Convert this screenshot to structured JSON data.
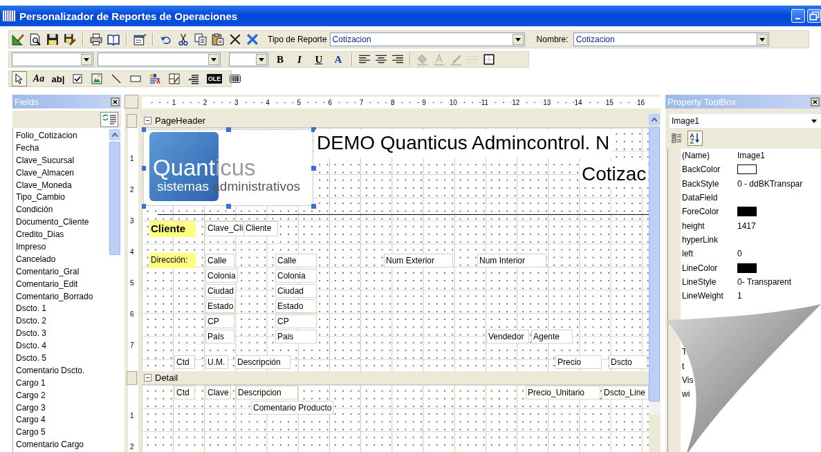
{
  "window": {
    "title": "Personalizador de Reportes de Operaciones"
  },
  "main_toolbar": {
    "buttons": [
      {
        "kind": "design"
      },
      {
        "kind": "preview"
      },
      {
        "kind": "save"
      },
      {
        "kind": "save_edit"
      },
      {
        "kind": "print"
      },
      {
        "kind": "book"
      },
      {
        "kind": "properties"
      },
      {
        "kind": "undo"
      },
      {
        "kind": "cut"
      },
      {
        "kind": "copy"
      },
      {
        "kind": "paste"
      },
      {
        "kind": "delete"
      },
      {
        "kind": "delete_all"
      }
    ],
    "report_type": {
      "label": "Tipo de Reporte",
      "value": "Cotizacion"
    },
    "report_name": {
      "label": "Nombre:",
      "value": "Cotizacion"
    }
  },
  "format_toolbar": {
    "style_buttons": [
      {
        "kind": "bold",
        "label": "B"
      },
      {
        "kind": "italic",
        "label": "I"
      },
      {
        "kind": "underline",
        "label": "U"
      },
      {
        "kind": "color",
        "label": "A"
      }
    ],
    "buttons": [
      {
        "kind": "align_left",
        "disabled": false
      },
      {
        "kind": "align_center",
        "disabled": false
      },
      {
        "kind": "align_right",
        "disabled": false
      },
      {
        "kind": "fill",
        "disabled": true
      },
      {
        "kind": "font_color",
        "disabled": true
      },
      {
        "kind": "line_color",
        "disabled": true
      },
      {
        "kind": "line_style",
        "disabled": true
      },
      {
        "kind": "border",
        "disabled": false
      }
    ]
  },
  "toolbox": [
    {
      "kind": "pointer",
      "selected": true
    },
    {
      "kind": "label",
      "label": "Aa",
      "selected": false
    },
    {
      "kind": "textbox",
      "label": "ab|",
      "selected": false
    },
    {
      "kind": "checkbox",
      "selected": false
    },
    {
      "kind": "picture",
      "selected": false
    },
    {
      "kind": "line",
      "selected": false
    },
    {
      "kind": "shape",
      "selected": false
    },
    {
      "kind": "rich_text",
      "selected": false
    },
    {
      "kind": "subreport",
      "selected": false
    },
    {
      "kind": "page_break",
      "selected": false
    },
    {
      "kind": "ole",
      "label": "OLE",
      "selected": false
    },
    {
      "kind": "barcode",
      "selected": false
    }
  ],
  "fields_panel": {
    "title": "Fields",
    "items": [
      "Folio_Cotizacion",
      "Fecha",
      "Clave_Sucursal",
      "Clave_Almacen",
      "Clave_Moneda",
      "Tipo_Cambio",
      "Condición",
      "Documento_Cliente",
      "Credito_Dias",
      "Impreso",
      "Cancelado",
      "Comentario_Gral",
      "Comentario_Edit",
      "Comentario_Borrado",
      "Dscto. 1",
      "Dscto. 2",
      "Dscto. 3",
      "Dscto. 4",
      "Dscto. 5",
      "Comentario Dscto.",
      "Cargo 1",
      "Cargo 2",
      "Cargo 3",
      "Cargo 4",
      "Cargo 5",
      "Comentario Cargo"
    ]
  },
  "ruler": [
    "1",
    "2",
    "3",
    "4",
    "5",
    "6",
    "7",
    "8",
    "9",
    "10",
    "11",
    "12",
    "13",
    "14",
    "15",
    "16"
  ],
  "sections": [
    {
      "title": "PageHeader",
      "expanded": true,
      "ruler": [
        "1",
        "2",
        "3",
        "4",
        "5",
        "6",
        "7"
      ],
      "controls": [
        {
          "kind": "image",
          "selected": true,
          "logo": {
            "word_1": "Quant",
            "word_2": "icus",
            "tagline_1": "sistemas",
            "tagline_2": "administrativos"
          }
        },
        {
          "kind": "title",
          "text": "DEMO Quanticus Admincontrol. N"
        },
        {
          "kind": "title",
          "text": "Cotizac"
        },
        {
          "kind": "highlight",
          "text": "Cliente"
        },
        {
          "kind": "label",
          "text": "Clave_Cli"
        },
        {
          "kind": "label",
          "text": "Cliente"
        },
        {
          "kind": "highlight",
          "text": "Dirección:"
        },
        {
          "kind": "label",
          "text": "Calle"
        },
        {
          "kind": "label",
          "text": "Colonia"
        },
        {
          "kind": "label",
          "text": "Ciudad"
        },
        {
          "kind": "label",
          "text": "Estado"
        },
        {
          "kind": "label",
          "text": "CP"
        },
        {
          "kind": "label",
          "text": "País"
        },
        {
          "kind": "label",
          "text": "Calle"
        },
        {
          "kind": "label",
          "text": "Colonia"
        },
        {
          "kind": "label",
          "text": "Ciudad"
        },
        {
          "kind": "label",
          "text": "Estado"
        },
        {
          "kind": "label",
          "text": "CP"
        },
        {
          "kind": "label",
          "text": "Pais"
        },
        {
          "kind": "label",
          "text": "Num Exterior"
        },
        {
          "kind": "label",
          "text": "Num Interior"
        },
        {
          "kind": "label",
          "text": "Vendedor"
        },
        {
          "kind": "label",
          "text": "Agente"
        },
        {
          "kind": "label",
          "text": "Ctd"
        },
        {
          "kind": "label",
          "text": "U.M."
        },
        {
          "kind": "label",
          "text": "Descripción"
        },
        {
          "kind": "label",
          "text": "Precio"
        },
        {
          "kind": "label",
          "text": "Dscto"
        }
      ]
    },
    {
      "title": "Detail",
      "expanded": true,
      "ruler": [
        "1",
        "2"
      ],
      "controls": [
        {
          "kind": "label",
          "text": "Ctd"
        },
        {
          "kind": "label",
          "text": "Clave"
        },
        {
          "kind": "label",
          "text": "Descripcion"
        },
        {
          "kind": "label",
          "text": "Precio_Unitario"
        },
        {
          "kind": "label",
          "text": "Dscto_Line"
        },
        {
          "kind": "label",
          "text": "Comentario Producto"
        }
      ]
    }
  ],
  "property_toolbox": {
    "title": "Property ToolBox",
    "object": "Image1",
    "views": [
      {
        "kind": "categorized",
        "selected": false
      },
      {
        "kind": "alphabetic",
        "selected": true
      }
    ],
    "properties": [
      {
        "name": "(Name)",
        "value": "Image1"
      },
      {
        "name": "BackColor",
        "color": "#ffffff"
      },
      {
        "name": "BackStyle",
        "value": "0 - ddBKTranspar"
      },
      {
        "name": "DataField"
      },
      {
        "name": "ForeColor",
        "color": "#000000"
      },
      {
        "name": "height",
        "value": "1417"
      },
      {
        "name": "hyperLink"
      },
      {
        "name": "left",
        "value": "0"
      },
      {
        "name": "LineColor",
        "color": "#000000"
      },
      {
        "name": "LineStyle",
        "value": "0- Transparent"
      },
      {
        "name": "LineWeight",
        "value": "1"
      }
    ],
    "covered_properties": [
      "T",
      "t",
      "Vis",
      "wi"
    ]
  }
}
